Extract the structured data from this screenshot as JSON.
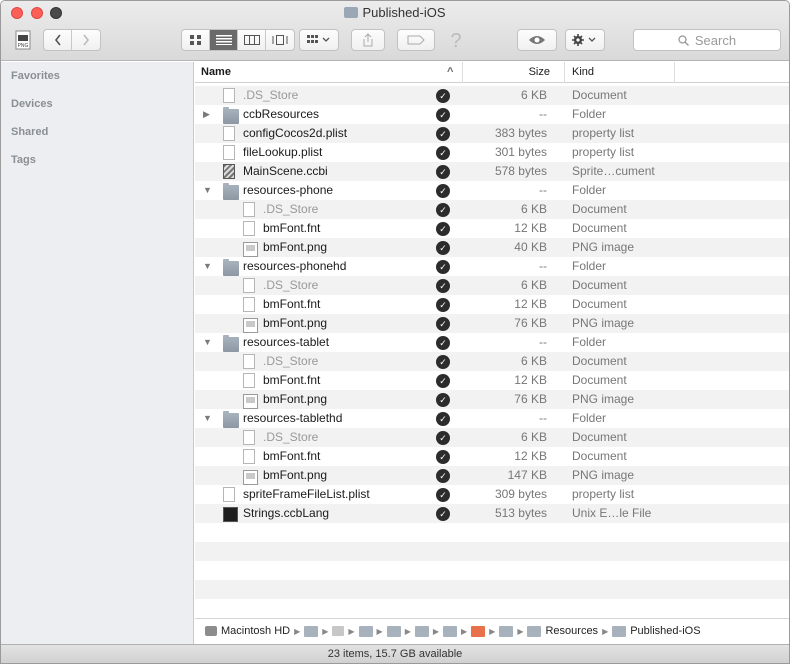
{
  "window": {
    "title": "Published-iOS"
  },
  "toolbar": {
    "search_placeholder": "Search",
    "back_icon": "chevron-left-icon",
    "forward_icon": "chevron-right-icon",
    "view_modes": [
      "icon-view",
      "list-view",
      "column-view",
      "cover-flow-view"
    ],
    "active_view": "list-view"
  },
  "sidebar": {
    "sections": [
      {
        "label": "Favorites"
      },
      {
        "label": "Devices"
      },
      {
        "label": "Shared"
      },
      {
        "label": "Tags"
      }
    ]
  },
  "columns": {
    "name": "Name",
    "size": "Size",
    "kind": "Kind",
    "sort_indicator": "^"
  },
  "files": [
    {
      "name": ".DS_Store",
      "size": "6 KB",
      "kind": "Document",
      "level": 0,
      "type": "doc",
      "dim": true,
      "expandable": false,
      "expanded": false
    },
    {
      "name": "ccbResources",
      "size": "--",
      "kind": "Folder",
      "level": 0,
      "type": "folder",
      "dim": false,
      "expandable": true,
      "expanded": false
    },
    {
      "name": "configCocos2d.plist",
      "size": "383 bytes",
      "kind": "property list",
      "level": 0,
      "type": "doc",
      "dim": false,
      "expandable": false,
      "expanded": false
    },
    {
      "name": "fileLookup.plist",
      "size": "301 bytes",
      "kind": "property list",
      "level": 0,
      "type": "doc",
      "dim": false,
      "expandable": false,
      "expanded": false
    },
    {
      "name": "MainScene.ccbi",
      "size": "578 bytes",
      "kind": "Sprite…cument",
      "level": 0,
      "type": "ccbi",
      "dim": false,
      "expandable": false,
      "expanded": false
    },
    {
      "name": "resources-phone",
      "size": "--",
      "kind": "Folder",
      "level": 0,
      "type": "folder",
      "dim": false,
      "expandable": true,
      "expanded": true
    },
    {
      "name": ".DS_Store",
      "size": "6 KB",
      "kind": "Document",
      "level": 1,
      "type": "doc",
      "dim": true,
      "expandable": false,
      "expanded": false
    },
    {
      "name": "bmFont.fnt",
      "size": "12 KB",
      "kind": "Document",
      "level": 1,
      "type": "doc",
      "dim": false,
      "expandable": false,
      "expanded": false
    },
    {
      "name": "bmFont.png",
      "size": "40 KB",
      "kind": "PNG image",
      "level": 1,
      "type": "img",
      "dim": false,
      "expandable": false,
      "expanded": false
    },
    {
      "name": "resources-phonehd",
      "size": "--",
      "kind": "Folder",
      "level": 0,
      "type": "folder",
      "dim": false,
      "expandable": true,
      "expanded": true
    },
    {
      "name": ".DS_Store",
      "size": "6 KB",
      "kind": "Document",
      "level": 1,
      "type": "doc",
      "dim": true,
      "expandable": false,
      "expanded": false
    },
    {
      "name": "bmFont.fnt",
      "size": "12 KB",
      "kind": "Document",
      "level": 1,
      "type": "doc",
      "dim": false,
      "expandable": false,
      "expanded": false
    },
    {
      "name": "bmFont.png",
      "size": "76 KB",
      "kind": "PNG image",
      "level": 1,
      "type": "img",
      "dim": false,
      "expandable": false,
      "expanded": false
    },
    {
      "name": "resources-tablet",
      "size": "--",
      "kind": "Folder",
      "level": 0,
      "type": "folder",
      "dim": false,
      "expandable": true,
      "expanded": true
    },
    {
      "name": ".DS_Store",
      "size": "6 KB",
      "kind": "Document",
      "level": 1,
      "type": "doc",
      "dim": true,
      "expandable": false,
      "expanded": false
    },
    {
      "name": "bmFont.fnt",
      "size": "12 KB",
      "kind": "Document",
      "level": 1,
      "type": "doc",
      "dim": false,
      "expandable": false,
      "expanded": false
    },
    {
      "name": "bmFont.png",
      "size": "76 KB",
      "kind": "PNG image",
      "level": 1,
      "type": "img",
      "dim": false,
      "expandable": false,
      "expanded": false
    },
    {
      "name": "resources-tablethd",
      "size": "--",
      "kind": "Folder",
      "level": 0,
      "type": "folder",
      "dim": false,
      "expandable": true,
      "expanded": true
    },
    {
      "name": ".DS_Store",
      "size": "6 KB",
      "kind": "Document",
      "level": 1,
      "type": "doc",
      "dim": true,
      "expandable": false,
      "expanded": false
    },
    {
      "name": "bmFont.fnt",
      "size": "12 KB",
      "kind": "Document",
      "level": 1,
      "type": "doc",
      "dim": false,
      "expandable": false,
      "expanded": false
    },
    {
      "name": "bmFont.png",
      "size": "147 KB",
      "kind": "PNG image",
      "level": 1,
      "type": "img",
      "dim": false,
      "expandable": false,
      "expanded": false
    },
    {
      "name": "spriteFrameFileList.plist",
      "size": "309 bytes",
      "kind": "property list",
      "level": 0,
      "type": "doc",
      "dim": false,
      "expandable": false,
      "expanded": false
    },
    {
      "name": "Strings.ccbLang",
      "size": "513 bytes",
      "kind": "Unix E…le File",
      "level": 0,
      "type": "term",
      "dim": false,
      "expandable": false,
      "expanded": false
    }
  ],
  "pathbar": {
    "items": [
      {
        "label": "Macintosh HD",
        "icon": "hard-drive-icon"
      },
      {
        "label": "",
        "icon": "folder-icon"
      },
      {
        "label": "",
        "icon": "home-icon"
      },
      {
        "label": "",
        "icon": "folder-icon"
      },
      {
        "label": "",
        "icon": "folder-icon"
      },
      {
        "label": "",
        "icon": "folder-icon"
      },
      {
        "label": "",
        "icon": "folder-icon"
      },
      {
        "label": "",
        "icon": "orange-folder-icon"
      },
      {
        "label": "",
        "icon": "folder-icon"
      },
      {
        "label": "Resources",
        "icon": "folder-icon"
      },
      {
        "label": "Published-iOS",
        "icon": "folder-icon"
      }
    ]
  },
  "status": {
    "text": "23 items, 15.7 GB available"
  },
  "colors": {
    "close": "#fc5f57",
    "minimize": "#fc5f57",
    "zoom": "#4a4a4a",
    "sidebar_bg": "#eceef1",
    "row_alt": "#f2f2f2",
    "check_badge": "#2c2c2c",
    "highlight_folder": "#e8704b"
  }
}
